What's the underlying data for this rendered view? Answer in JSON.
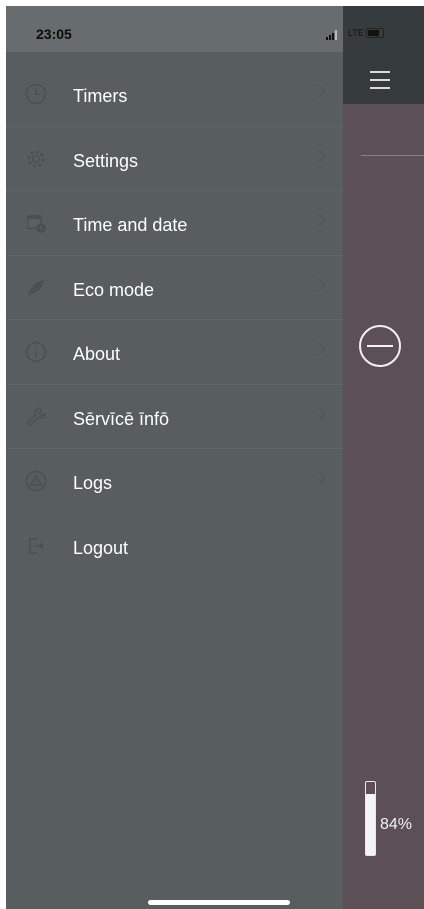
{
  "status_bar": {
    "time": "23:05",
    "network": "LTE",
    "icons": [
      "signal-icon",
      "battery-icon"
    ]
  },
  "drawer": {
    "items": [
      {
        "label": "Timers",
        "icon": "clock-icon",
        "has_chevron": true
      },
      {
        "label": "Settings",
        "icon": "gear-icon",
        "has_chevron": true
      },
      {
        "label": "Time and date",
        "icon": "calendar-clock-icon",
        "has_chevron": true
      },
      {
        "label": "Eco mode",
        "icon": "leaf-icon",
        "has_chevron": true
      },
      {
        "label": "About",
        "icon": "info-icon",
        "has_chevron": true
      },
      {
        "label": "Sērvīcē īnfō",
        "icon": "wrench-icon",
        "has_chevron": true
      },
      {
        "label": "Logs",
        "icon": "warning-icon",
        "has_chevron": true
      },
      {
        "label": "Logout",
        "icon": "logout-icon",
        "has_chevron": false
      }
    ]
  },
  "main": {
    "menu_icon": "hamburger-icon",
    "minus_icon": "minus-circle-icon",
    "level_percent": 84,
    "level_text": "84%"
  },
  "colors": {
    "drawer_bg": "#585e60",
    "main_bg": "#5c4f55",
    "header_bg": "#363c3d",
    "text": "#ffffff",
    "icon": "#4b5153"
  }
}
